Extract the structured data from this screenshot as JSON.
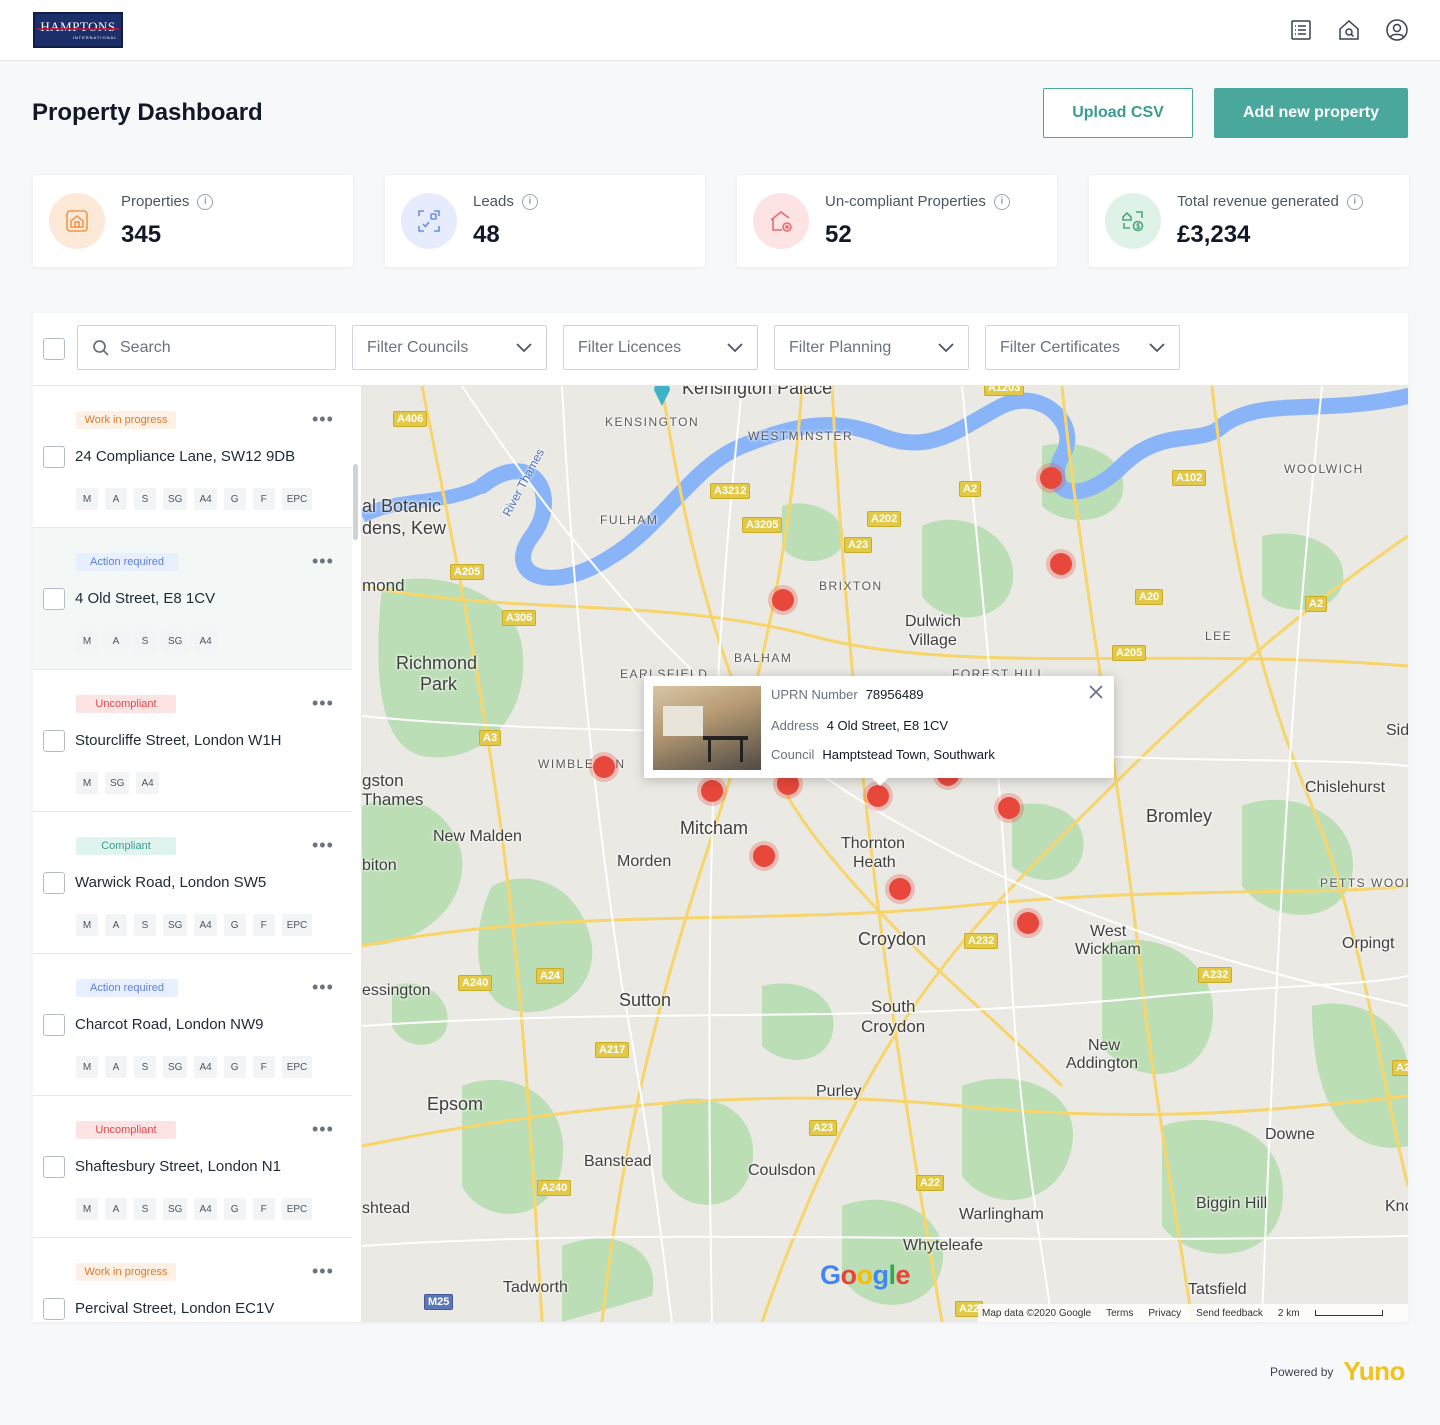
{
  "brand": {
    "logo_text": "HAMPTONS",
    "logo_sub": "INTERNATIONAL"
  },
  "header": {
    "icons": [
      "list-icon",
      "home-search-icon",
      "user-icon"
    ],
    "title": "Property Dashboard",
    "upload_label": "Upload CSV",
    "add_label": "Add new property"
  },
  "stats": [
    {
      "label": "Properties",
      "value": "345",
      "icon": "home-icon",
      "color": "#f0984a"
    },
    {
      "label": "Leads",
      "value": "48",
      "icon": "scan-check-icon",
      "color": "#6b8ee6"
    },
    {
      "label": "Un-compliant Properties",
      "value": "52",
      "icon": "home-alert-icon",
      "color": "#e86b6b"
    },
    {
      "label": "Total revenue generated",
      "value": "£3,234",
      "icon": "revenue-icon",
      "color": "#4fa67d"
    }
  ],
  "filters": {
    "search_placeholder": "Search",
    "councils": "Filter Councils",
    "licences": "Filter Licences",
    "planning": "Filter Planning",
    "certificates": "Filter Certificates"
  },
  "properties": [
    {
      "status": "Work in progress",
      "address": "24 Compliance Lane, SW12 9DB",
      "tags": [
        "M",
        "A",
        "S",
        "SG",
        "A4",
        "G",
        "F",
        "EPC"
      ]
    },
    {
      "status": "Action required",
      "address": "4 Old Street, E8 1CV",
      "tags": [
        "M",
        "A",
        "S",
        "SG",
        "A4"
      ]
    },
    {
      "status": "Uncompliant",
      "address": "Stourcliffe Street, London W1H",
      "tags": [
        "M",
        "SG",
        "A4"
      ]
    },
    {
      "status": "Compliant",
      "address": "Warwick Road, London SW5",
      "tags": [
        "M",
        "A",
        "S",
        "SG",
        "A4",
        "G",
        "F",
        "EPC"
      ]
    },
    {
      "status": "Action required",
      "address": "Charcot Road, London NW9",
      "tags": [
        "M",
        "A",
        "S",
        "SG",
        "A4",
        "G",
        "F",
        "EPC"
      ]
    },
    {
      "status": "Uncompliant",
      "address": "Shaftesbury Street, London N1",
      "tags": [
        "M",
        "A",
        "S",
        "SG",
        "A4",
        "G",
        "F",
        "EPC"
      ]
    },
    {
      "status": "Work in progress",
      "address": "Percival Street, London EC1V",
      "tags": []
    }
  ],
  "map": {
    "popup": {
      "uprn_label": "UPRN Number",
      "uprn": "78956489",
      "address_label": "Address",
      "address": "4 Old Street, E8 1CV",
      "council_label": "Council",
      "council": "Hamptstead Town, Southwark"
    },
    "places": [
      "Kensington Palace",
      "KENSINGTON",
      "WESTMINSTER",
      "WOOLWICH",
      "FULHAM",
      "al Botanic",
      "dens, Kew",
      "BRIXTON",
      "mond",
      "Dulwich",
      "Village",
      "LEE",
      "BALHAM",
      "Richmond",
      "Park",
      "EARLSFIELD",
      "FOREST HILL",
      "Sid",
      "gston",
      "Thames",
      "WIMBLEDON",
      "Chislehurst",
      "Mitcham",
      "Thornton",
      "Heath",
      "Bromley",
      "New Malden",
      "biton",
      "Morden",
      "PETTS WOOD",
      "Croydon",
      "West",
      "Wickham",
      "Orpingt",
      "essington",
      "Sutton",
      "South",
      "Croydon",
      "New",
      "Addington",
      "Epsom",
      "Purley",
      "Downe",
      "Banstead",
      "Coulsdon",
      "shtead",
      "Warlingham",
      "Biggin Hill",
      "Kno",
      "Whyteleafe",
      "Tadworth",
      "Tatsfield",
      "River Thames"
    ],
    "roads": [
      "A406",
      "A3212",
      "A2",
      "A102",
      "A3205",
      "A202",
      "A23",
      "A205",
      "A306",
      "A20",
      "A2",
      "A205",
      "A3",
      "A232",
      "A240",
      "A24",
      "A232",
      "A217",
      "A23",
      "A240",
      "A22",
      "M25",
      "A21",
      "A22",
      "A1203"
    ],
    "attribution": [
      "Map data ©2020 Google",
      "Terms",
      "Privacy",
      "Send feedback",
      "2 km"
    ],
    "google": "Google"
  },
  "footer": {
    "powered": "Powered by",
    "brand": "Yuno"
  },
  "colors": {
    "accent": "#4aa79b",
    "pin": "#e8483c",
    "brand_yellow": "#f2c21a"
  }
}
